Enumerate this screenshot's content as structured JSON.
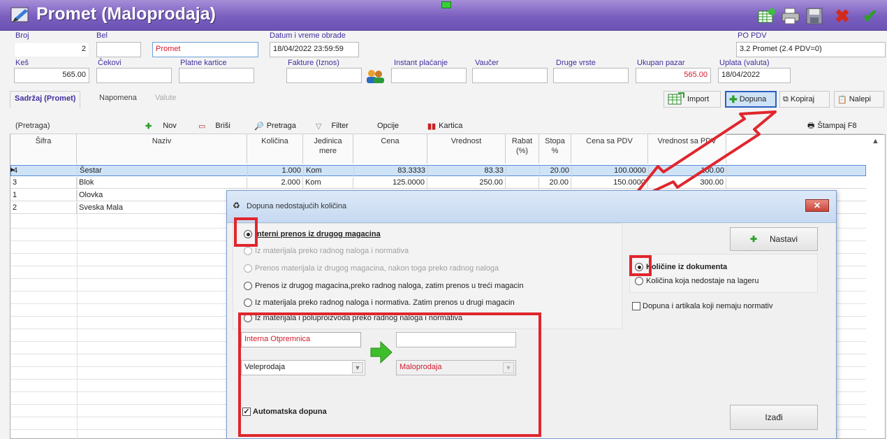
{
  "window": {
    "title": "Promet (Maloprodaja)"
  },
  "header": {
    "broj": {
      "label": "Broj",
      "value": "2"
    },
    "bel": {
      "label": "Bel",
      "value": "",
      "value2": "Promet"
    },
    "datum": {
      "label": "Datum i vreme obrade",
      "value": "18/04/2022 23:59:59"
    },
    "po_pdv": {
      "label": "PO PDV",
      "value": "3.2 Promet (2.4 PDV=0)"
    },
    "kes": {
      "label": "Keš",
      "value": "565.00"
    },
    "cekovi": {
      "label": "Čekovi",
      "value": ""
    },
    "platne": {
      "label": "Platne kartice",
      "value": ""
    },
    "fakture": {
      "label": "Fakture (Iznos)",
      "value": ""
    },
    "instant": {
      "label": "Instant plaćanje",
      "value": ""
    },
    "vaucer": {
      "label": "Vaučer",
      "value": ""
    },
    "druge": {
      "label": "Druge vrste",
      "value": ""
    },
    "ukupan": {
      "label": "Ukupan pazar",
      "value": "565.00"
    },
    "uplata": {
      "label": "Uplata (valuta)",
      "value": "18/04/2022"
    }
  },
  "tabs": [
    "Sadržaj (Promet)",
    "Napomena",
    "Valute"
  ],
  "right_buttons": {
    "import": "Import",
    "dopuna": "Dopuna",
    "kopiraj": "Kopiraj",
    "nalepi": "Nalepi"
  },
  "toolbar": {
    "search_placeholder": "(Pretraga)",
    "nov": "Nov",
    "brisi": "Briši",
    "pretraga": "Pretraga",
    "filter": "Filter",
    "opcije": "Opcije",
    "kartica": "Kartica",
    "stampaj": "Štampaj F8"
  },
  "grid": {
    "headers": [
      "Šifra",
      "Naziv",
      "Količina",
      "Jedinica mere",
      "Cena",
      "Vrednost",
      "Rabat (%)",
      "Stopa %",
      "Cena sa PDV",
      "Vrednost sa PDV"
    ],
    "rows": [
      {
        "sifra": "4",
        "naziv": "Šestar",
        "kolicina": "1.000",
        "jm": "Kom",
        "cena": "83.3333",
        "vrednost": "83.33",
        "rabat": "",
        "stopa": "20.00",
        "cena_pdv": "100.0000",
        "vrednost_pdv": "100.00"
      },
      {
        "sifra": "3",
        "naziv": "Blok",
        "kolicina": "2.000",
        "jm": "Kom",
        "cena": "125.0000",
        "vrednost": "250.00",
        "rabat": "",
        "stopa": "20.00",
        "cena_pdv": "150.0000",
        "vrednost_pdv": "300.00"
      },
      {
        "sifra": "1",
        "naziv": "Olovka",
        "kolicina": "",
        "jm": "",
        "cena": "",
        "vrednost": "",
        "rabat": "",
        "stopa": "",
        "cena_pdv": "",
        "vrednost_pdv": ""
      },
      {
        "sifra": "2",
        "naziv": "Sveska Mala",
        "kolicina": "",
        "jm": "",
        "cena": "",
        "vrednost": "",
        "rabat": "",
        "stopa": "",
        "cena_pdv": "",
        "vrednost_pdv": ""
      }
    ]
  },
  "dialog": {
    "title": "Dopuna nedostajućih količina",
    "options": [
      "Interni prenos iz drugog magacina",
      "Iz materijala preko radnog naloga i normativa",
      "Prenos materijala iz drugog magacina, nakon toga preko radnog naloga",
      "Prenos iz drugog magacina,preko radnog naloga, zatim prenos u treći magacin",
      "Iz materijala preko radnog naloga i normativa. Zatim prenos u drugi magacin",
      "Iz materijala i poluproizvoda preko radnog naloga i normativa"
    ],
    "doc_type": "Interna Otpremnica",
    "doc_type2": "",
    "from_warehouse": "Veleprodaja",
    "to_warehouse": "Maloprodaja",
    "auto_label": "Automatska dopuna",
    "nastavi": "Nastavi",
    "izadi": "Izađi",
    "qty_options": [
      "Količine iz dokumenta",
      "Količina koja nedostaje na lageru"
    ],
    "no_norm_label": "Dopuna i artikala koji nemaju normativ"
  },
  "colors": {
    "title_bar": "#7a5fbf",
    "label": "#3f2f9f",
    "highlight": "#e0262d",
    "selection": "#cfe3f7"
  }
}
